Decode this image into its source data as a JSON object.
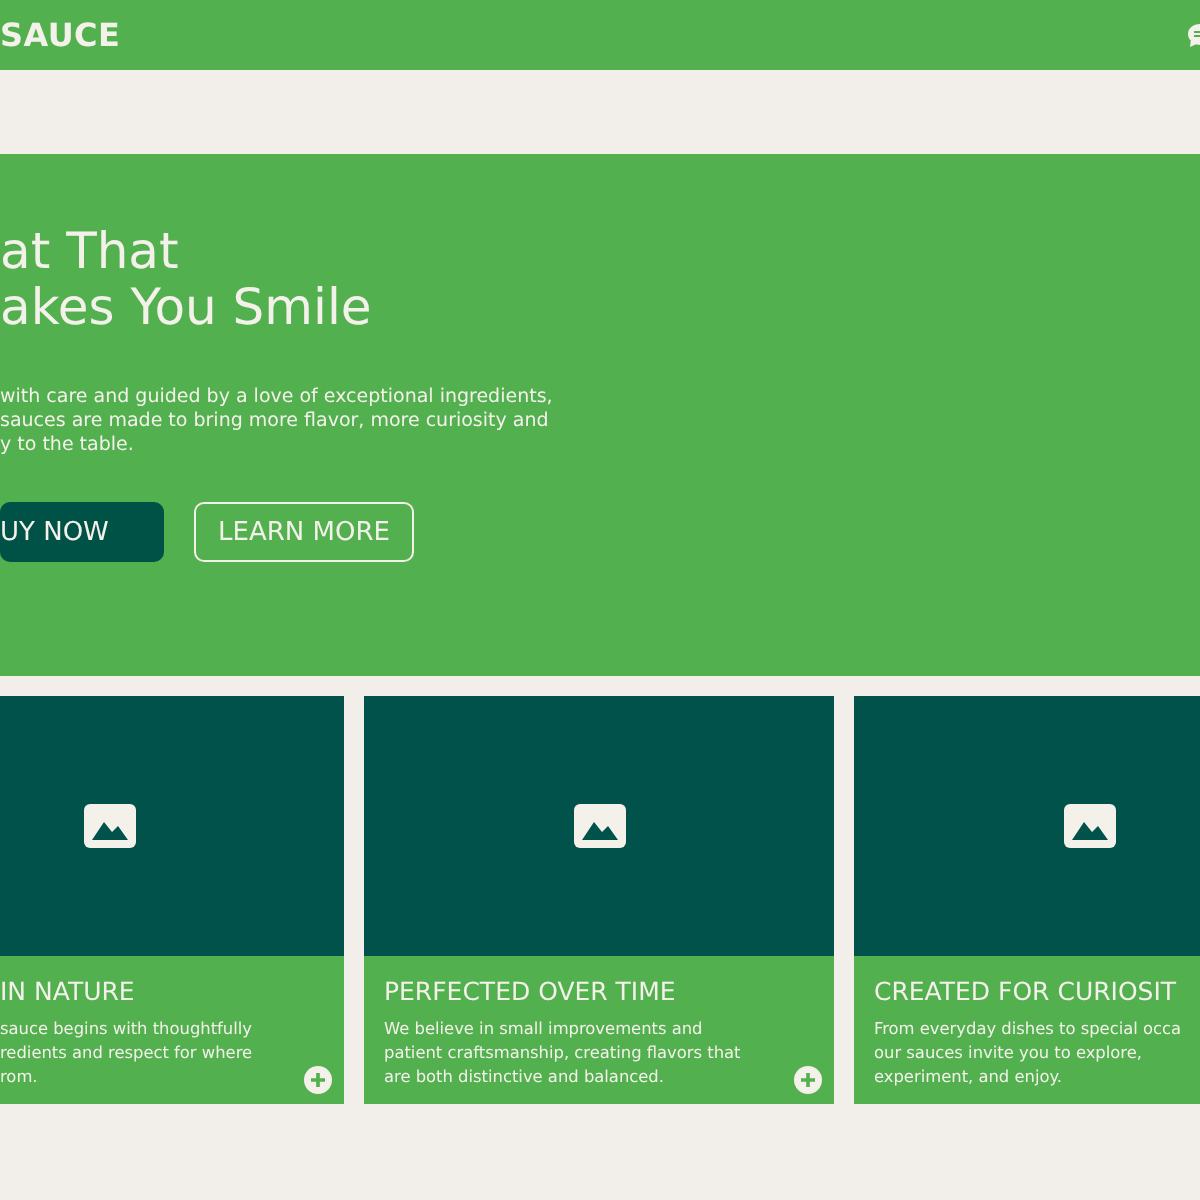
{
  "header": {
    "brand": "SAUCE"
  },
  "hero": {
    "title_lines": [
      "at That",
      "akes You Smile"
    ],
    "text_lines": [
      "with care and guided by a love of exceptional ingredients,",
      "sauces are made to bring more flavor, more curiosity and",
      "y to the table."
    ],
    "buttons": [
      {
        "label": "UY NOW",
        "kind": "primary"
      },
      {
        "label": "LEARN MORE",
        "kind": "outline"
      }
    ]
  },
  "cards": [
    {
      "title": "IN NATURE",
      "text_lines": [
        "sauce begins with thoughtfully",
        "redients and respect for where",
        "rom."
      ],
      "add_button": true
    },
    {
      "title": "PERFECTED OVER TIME",
      "text_lines": [
        "We believe in small improvements and",
        "patient craftsmanship, creating flavors that",
        "are both distinctive and balanced."
      ],
      "add_button": true
    },
    {
      "title": "CREATED FOR CURIOSIT",
      "text_lines": [
        "From everyday dishes to special occa",
        "our sauces invite you to explore,",
        "experiment, and enjoy."
      ],
      "add_button": false
    }
  ]
}
